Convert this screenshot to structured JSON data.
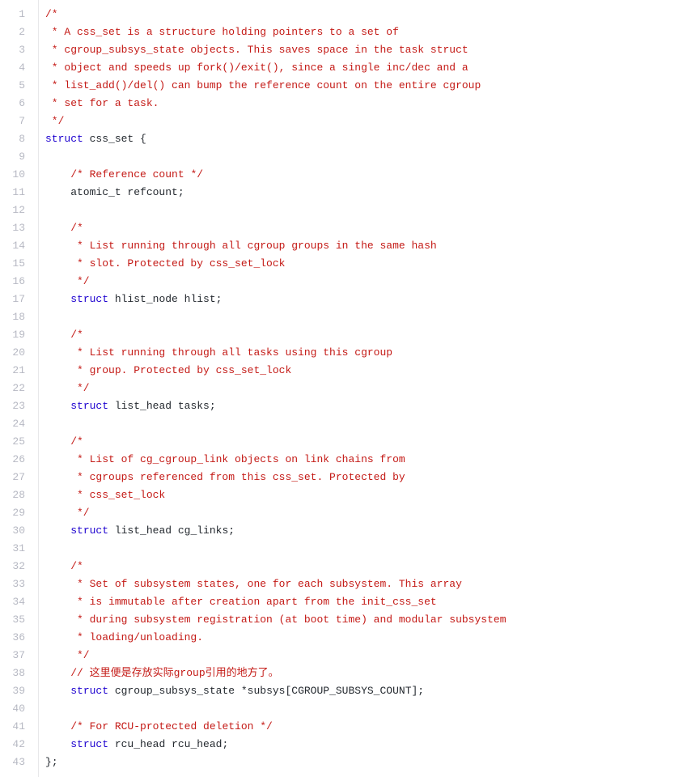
{
  "colors": {
    "comment": "#C41A16",
    "keyword": "#1c00cf",
    "plain": "#24292f",
    "line_number": "#b7b9c3"
  },
  "lines": [
    {
      "n": 1,
      "tokens": [
        {
          "c": "comment",
          "t": "/*"
        }
      ]
    },
    {
      "n": 2,
      "tokens": [
        {
          "c": "comment",
          "t": " * A css_set is a structure holding pointers to a set of"
        }
      ]
    },
    {
      "n": 3,
      "tokens": [
        {
          "c": "comment",
          "t": " * cgroup_subsys_state objects. This saves space in the task struct"
        }
      ]
    },
    {
      "n": 4,
      "tokens": [
        {
          "c": "comment",
          "t": " * object and speeds up fork()/exit(), since a single inc/dec and a"
        }
      ]
    },
    {
      "n": 5,
      "tokens": [
        {
          "c": "comment",
          "t": " * list_add()/del() can bump the reference count on the entire cgroup"
        }
      ]
    },
    {
      "n": 6,
      "tokens": [
        {
          "c": "comment",
          "t": " * set for a task."
        }
      ]
    },
    {
      "n": 7,
      "tokens": [
        {
          "c": "comment",
          "t": " */"
        }
      ]
    },
    {
      "n": 8,
      "tokens": [
        {
          "c": "keyword",
          "t": "struct"
        },
        {
          "c": "plain",
          "t": " css_set {"
        }
      ]
    },
    {
      "n": 9,
      "tokens": [
        {
          "c": "plain",
          "t": ""
        }
      ]
    },
    {
      "n": 10,
      "tokens": [
        {
          "c": "plain",
          "t": "    "
        },
        {
          "c": "comment",
          "t": "/* Reference count */"
        }
      ]
    },
    {
      "n": 11,
      "tokens": [
        {
          "c": "plain",
          "t": "    atomic_t refcount;"
        }
      ]
    },
    {
      "n": 12,
      "tokens": [
        {
          "c": "plain",
          "t": ""
        }
      ]
    },
    {
      "n": 13,
      "tokens": [
        {
          "c": "plain",
          "t": "    "
        },
        {
          "c": "comment",
          "t": "/*"
        }
      ]
    },
    {
      "n": 14,
      "tokens": [
        {
          "c": "comment",
          "t": "     * List running through all cgroup groups in the same hash"
        }
      ]
    },
    {
      "n": 15,
      "tokens": [
        {
          "c": "comment",
          "t": "     * slot. Protected by css_set_lock"
        }
      ]
    },
    {
      "n": 16,
      "tokens": [
        {
          "c": "comment",
          "t": "     */"
        }
      ]
    },
    {
      "n": 17,
      "tokens": [
        {
          "c": "plain",
          "t": "    "
        },
        {
          "c": "keyword",
          "t": "struct"
        },
        {
          "c": "plain",
          "t": " hlist_node hlist;"
        }
      ]
    },
    {
      "n": 18,
      "tokens": [
        {
          "c": "plain",
          "t": ""
        }
      ]
    },
    {
      "n": 19,
      "tokens": [
        {
          "c": "plain",
          "t": "    "
        },
        {
          "c": "comment",
          "t": "/*"
        }
      ]
    },
    {
      "n": 20,
      "tokens": [
        {
          "c": "comment",
          "t": "     * List running through all tasks using this cgroup"
        }
      ]
    },
    {
      "n": 21,
      "tokens": [
        {
          "c": "comment",
          "t": "     * group. Protected by css_set_lock"
        }
      ]
    },
    {
      "n": 22,
      "tokens": [
        {
          "c": "comment",
          "t": "     */"
        }
      ]
    },
    {
      "n": 23,
      "tokens": [
        {
          "c": "plain",
          "t": "    "
        },
        {
          "c": "keyword",
          "t": "struct"
        },
        {
          "c": "plain",
          "t": " list_head tasks;"
        }
      ]
    },
    {
      "n": 24,
      "tokens": [
        {
          "c": "plain",
          "t": ""
        }
      ]
    },
    {
      "n": 25,
      "tokens": [
        {
          "c": "plain",
          "t": "    "
        },
        {
          "c": "comment",
          "t": "/*"
        }
      ]
    },
    {
      "n": 26,
      "tokens": [
        {
          "c": "comment",
          "t": "     * List of cg_cgroup_link objects on link chains from"
        }
      ]
    },
    {
      "n": 27,
      "tokens": [
        {
          "c": "comment",
          "t": "     * cgroups referenced from this css_set. Protected by"
        }
      ]
    },
    {
      "n": 28,
      "tokens": [
        {
          "c": "comment",
          "t": "     * css_set_lock"
        }
      ]
    },
    {
      "n": 29,
      "tokens": [
        {
          "c": "comment",
          "t": "     */"
        }
      ]
    },
    {
      "n": 30,
      "tokens": [
        {
          "c": "plain",
          "t": "    "
        },
        {
          "c": "keyword",
          "t": "struct"
        },
        {
          "c": "plain",
          "t": " list_head cg_links;"
        }
      ]
    },
    {
      "n": 31,
      "tokens": [
        {
          "c": "plain",
          "t": ""
        }
      ]
    },
    {
      "n": 32,
      "tokens": [
        {
          "c": "plain",
          "t": "    "
        },
        {
          "c": "comment",
          "t": "/*"
        }
      ]
    },
    {
      "n": 33,
      "tokens": [
        {
          "c": "comment",
          "t": "     * Set of subsystem states, one for each subsystem. This array"
        }
      ]
    },
    {
      "n": 34,
      "tokens": [
        {
          "c": "comment",
          "t": "     * is immutable after creation apart from the init_css_set"
        }
      ]
    },
    {
      "n": 35,
      "tokens": [
        {
          "c": "comment",
          "t": "     * during subsystem registration (at boot time) and modular subsystem"
        }
      ]
    },
    {
      "n": 36,
      "tokens": [
        {
          "c": "comment",
          "t": "     * loading/unloading."
        }
      ]
    },
    {
      "n": 37,
      "tokens": [
        {
          "c": "comment",
          "t": "     */"
        }
      ]
    },
    {
      "n": 38,
      "tokens": [
        {
          "c": "plain",
          "t": "    "
        },
        {
          "c": "comment",
          "t": "// 这里便是存放实际group引用的地方了。"
        }
      ]
    },
    {
      "n": 39,
      "tokens": [
        {
          "c": "plain",
          "t": "    "
        },
        {
          "c": "keyword",
          "t": "struct"
        },
        {
          "c": "plain",
          "t": " cgroup_subsys_state *subsys[CGROUP_SUBSYS_COUNT];"
        }
      ]
    },
    {
      "n": 40,
      "tokens": [
        {
          "c": "plain",
          "t": ""
        }
      ]
    },
    {
      "n": 41,
      "tokens": [
        {
          "c": "plain",
          "t": "    "
        },
        {
          "c": "comment",
          "t": "/* For RCU-protected deletion */"
        }
      ]
    },
    {
      "n": 42,
      "tokens": [
        {
          "c": "plain",
          "t": "    "
        },
        {
          "c": "keyword",
          "t": "struct"
        },
        {
          "c": "plain",
          "t": " rcu_head rcu_head;"
        }
      ]
    },
    {
      "n": 43,
      "tokens": [
        {
          "c": "plain",
          "t": "};"
        }
      ]
    }
  ]
}
